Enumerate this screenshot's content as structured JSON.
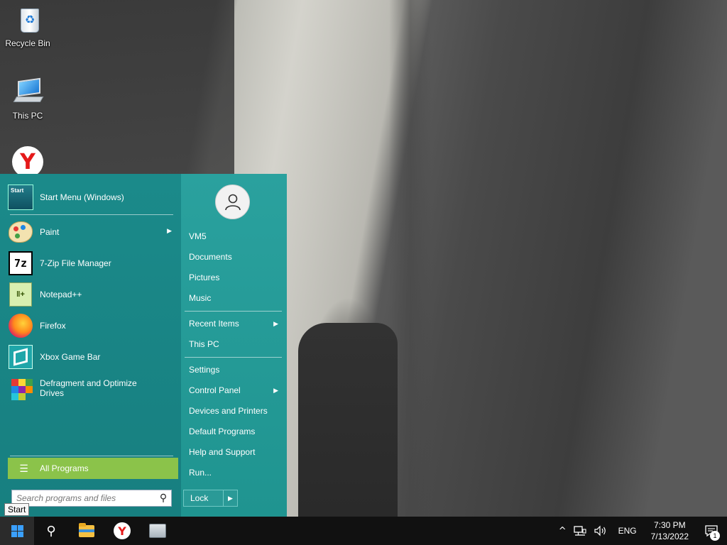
{
  "desktop": {
    "icons": [
      {
        "label": "Recycle Bin",
        "icon": "recycle-bin-icon"
      },
      {
        "label": "This PC",
        "icon": "computer-icon"
      },
      {
        "label": "",
        "icon": "yandex-browser-icon"
      }
    ]
  },
  "start_menu": {
    "pinned": {
      "label": "Start Menu (Windows)",
      "icon": "start-menu-app-icon",
      "icon_text": "Start"
    },
    "programs": [
      {
        "label": "Paint",
        "icon": "paint-palette-icon",
        "has_submenu": true
      },
      {
        "label": "7-Zip File Manager",
        "icon": "7zip-icon",
        "icon_text": "7z",
        "has_submenu": false
      },
      {
        "label": "Notepad++",
        "icon": "notepadpp-icon",
        "has_submenu": false
      },
      {
        "label": "Firefox",
        "icon": "firefox-icon",
        "has_submenu": false
      },
      {
        "label": "Xbox Game Bar",
        "icon": "xbox-game-bar-icon",
        "has_submenu": false
      },
      {
        "label": "Defragment and Optimize Drives",
        "icon": "defrag-icon",
        "has_submenu": false
      }
    ],
    "all_programs_label": "All Programs",
    "search": {
      "placeholder": "Search programs and files",
      "value": ""
    },
    "user": {
      "icon": "user-avatar-icon"
    },
    "right_items": [
      {
        "label": "VM5",
        "has_submenu": false
      },
      {
        "label": "Documents",
        "has_submenu": false
      },
      {
        "label": "Pictures",
        "has_submenu": false
      },
      {
        "label": "Music",
        "has_submenu": false
      },
      {
        "label": "Recent Items",
        "has_submenu": true
      },
      {
        "label": "This PC",
        "has_submenu": false
      },
      {
        "label": "Settings",
        "has_submenu": false
      },
      {
        "label": "Control Panel",
        "has_submenu": true
      },
      {
        "label": "Devices and Printers",
        "has_submenu": false
      },
      {
        "label": "Default Programs",
        "has_submenu": false
      },
      {
        "label": "Help and Support",
        "has_submenu": false
      },
      {
        "label": "Run...",
        "has_submenu": false
      }
    ],
    "lock_label": "Lock",
    "colors": {
      "menu_bg": "#1b8a8a",
      "right_bg": "#2aa19e",
      "all_programs_bg": "#8bc34a"
    }
  },
  "tooltip": "Start",
  "taskbar": {
    "buttons": [
      {
        "icon": "windows-start-icon"
      },
      {
        "icon": "search-icon"
      },
      {
        "icon": "file-explorer-icon"
      },
      {
        "icon": "yandex-browser-icon"
      },
      {
        "icon": "app-window-icon"
      }
    ],
    "tray": {
      "chevron": "^",
      "language": "ENG",
      "time": "7:30 PM",
      "date": "7/13/2022",
      "notification_count": "1"
    }
  }
}
